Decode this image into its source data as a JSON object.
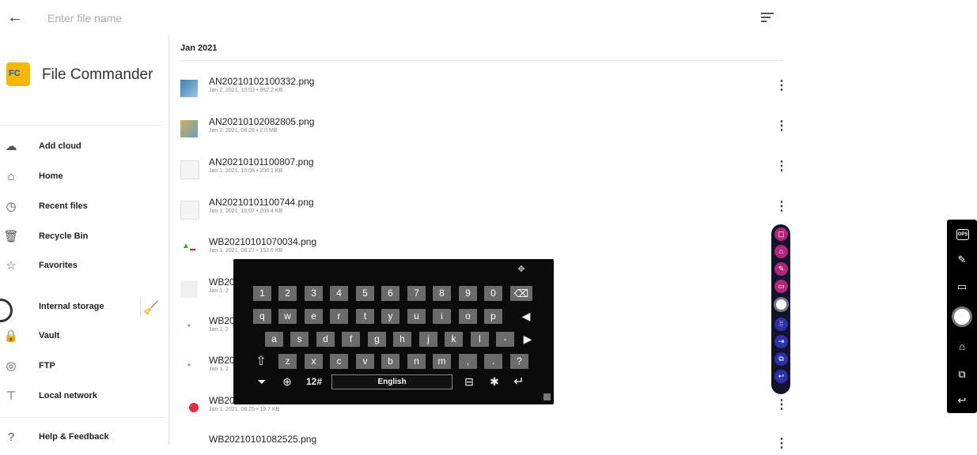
{
  "topbar": {
    "back_icon": "arrow-left-icon",
    "search_placeholder": "Enter file name",
    "sort_icon": "sort-lines-icon"
  },
  "sidebar": {
    "app_title": "File Commander",
    "logo_text": "FC",
    "items": [
      {
        "label": "Add cloud",
        "icon": "cloud-upload-icon"
      },
      {
        "label": "Home",
        "icon": "home-icon"
      },
      {
        "label": "Recent files",
        "icon": "clock-icon"
      },
      {
        "label": "Recycle Bin",
        "icon": "trash-icon"
      },
      {
        "label": "Favorites",
        "icon": "star-icon"
      },
      {
        "label": "Internal storage",
        "icon": "storage-icon"
      },
      {
        "label": "Vault",
        "icon": "lock-icon"
      },
      {
        "label": "FTP",
        "icon": "globe-icon"
      },
      {
        "label": "Local network",
        "icon": "network-icon"
      },
      {
        "label": "Help & Feedback",
        "icon": "help-icon"
      }
    ],
    "clean_icon": "broom-icon",
    "accent_color": "#2f7df6"
  },
  "files": {
    "month_header": "Jan 2021",
    "rows": [
      {
        "name": "AN20210102100332.png",
        "meta": "Jan 2, 2021, 10:03 • 862.2 KB"
      },
      {
        "name": "AN20210102082805.png",
        "meta": "Jan 2, 2021, 08:28 • 2.0 MB"
      },
      {
        "name": "AN20210101100807.png",
        "meta": "Jan 1, 2021, 10:08 • 206.1 KB"
      },
      {
        "name": "AN20210101100744.png",
        "meta": "Jan 1, 2021, 10:07 • 206.4 KB"
      },
      {
        "name": "WB20210101070034.png",
        "meta": "Jan 1, 2021, 08:27 • 153.6 KB"
      },
      {
        "name": "WB20",
        "meta": "Jan 1, 2"
      },
      {
        "name": "WB20",
        "meta": "Jan 1, 2"
      },
      {
        "name": "WB20",
        "meta": "Jan 1, 2"
      },
      {
        "name": "WB20",
        "meta": "Jan 1, 2021, 08:25 • 19.7 KB"
      },
      {
        "name": "WB20210101082525.png",
        "meta": ""
      }
    ],
    "menu_glyph": "⋮"
  },
  "keyboard": {
    "row1": [
      "1",
      "2",
      "3",
      "4",
      "5",
      "6",
      "7",
      "8",
      "9",
      "0"
    ],
    "row2": [
      "q",
      "w",
      "e",
      "r",
      "t",
      "y",
      "u",
      "i",
      "o",
      "p"
    ],
    "row3": [
      "a",
      "s",
      "d",
      "f",
      "g",
      "h",
      "j",
      "k",
      "l",
      "-"
    ],
    "row4": [
      "z",
      "x",
      "c",
      "v",
      "b",
      "n",
      "m",
      ",",
      ".",
      "?"
    ],
    "mode_key": "12#",
    "space_label": "English",
    "icons": {
      "move": "move-arrows-icon",
      "backspace": "backspace-icon",
      "cursor_left": "cursor-left-icon",
      "cursor_right": "cursor-right-icon",
      "shift": "shift-icon",
      "hide": "hide-keyboard-icon",
      "globe": "globe-icon",
      "layout": "keyboard-layout-icon",
      "settings": "gear-icon",
      "enter": "enter-icon",
      "resize": "resize-icon"
    }
  },
  "dock": {
    "buttons": [
      "annotate-icon",
      "home-icon",
      "edit-note-icon",
      "comment-icon",
      "circle-button",
      "apps-grid-icon",
      "input-source-icon",
      "windows-icon",
      "back-icon"
    ],
    "colors": {
      "magenta": "#b3267a",
      "blue": "#3030a8",
      "bar": "#13132e"
    }
  },
  "edgebar": {
    "ops_label": "OPS",
    "buttons": [
      "ops-icon",
      "edit-note-icon",
      "comment-icon",
      "circle-button",
      "home-icon",
      "windows-icon",
      "back-icon"
    ]
  }
}
